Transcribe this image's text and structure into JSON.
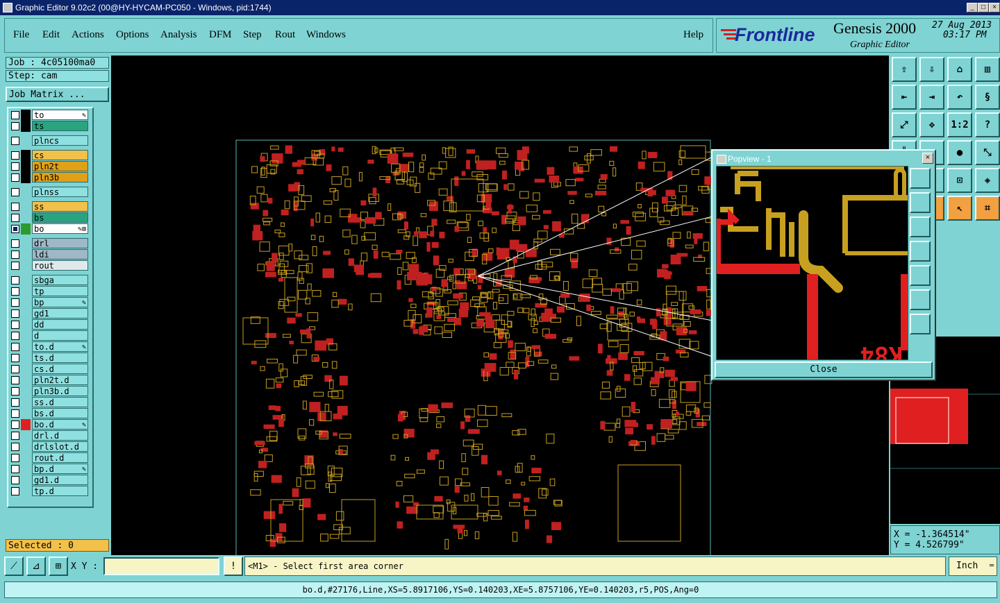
{
  "window": {
    "title": "Graphic Editor 9.02c2 (00@HY-HYCAM-PC050 - Windows, pid:1744)"
  },
  "menu": {
    "items": [
      "File",
      "Edit",
      "Actions",
      "Options",
      "Analysis",
      "DFM",
      "Step",
      "Rout",
      "Windows"
    ],
    "help": "Help"
  },
  "brand": {
    "logo": "Frontline",
    "product": "Genesis 2000",
    "sub": "Graphic Editor",
    "date": "27 Aug 2013",
    "time": "03:17 PM"
  },
  "job": {
    "job_label": "Job : 4c05100ma0",
    "step_label": "Step: cam",
    "matrix_button": "Job Matrix ..."
  },
  "layers": [
    {
      "name": "to",
      "color": "#ffffff",
      "swatch": "#000000",
      "mark": "✎"
    },
    {
      "name": "ts",
      "color": "#2aa37f",
      "swatch": "#000000",
      "mark": ""
    },
    {
      "name": "plncs",
      "color": "#8fe0e0",
      "swatch": "#7fd3d3",
      "mark": ""
    },
    {
      "name": "cs",
      "color": "#f2c14a",
      "swatch": "#000000",
      "mark": ""
    },
    {
      "name": "pln2t",
      "color": "#e0a018",
      "swatch": "#000000",
      "mark": ""
    },
    {
      "name": "pln3b",
      "color": "#e0a018",
      "swatch": "#000000",
      "mark": ""
    },
    {
      "name": "plnss",
      "color": "#8fe0e0",
      "swatch": "#7fd3d3",
      "mark": ""
    },
    {
      "name": "ss",
      "color": "#f2c14a",
      "swatch": "#7fd3d3",
      "mark": ""
    },
    {
      "name": "bs",
      "color": "#2aa37f",
      "swatch": "#7fd3d3",
      "mark": ""
    },
    {
      "name": "bo",
      "color": "#ffffff",
      "swatch": "#2e9a2e",
      "mark": "✎⊞"
    },
    {
      "name": "drl",
      "color": "#9fb8c8",
      "swatch": "#7fd3d3",
      "mark": ""
    },
    {
      "name": "ldi",
      "color": "#9fb8c8",
      "swatch": "#7fd3d3",
      "mark": ""
    },
    {
      "name": "rout",
      "color": "#e0e8ec",
      "swatch": "#7fd3d3",
      "mark": ""
    },
    {
      "name": "sbga",
      "color": "#8fe0e0",
      "swatch": "#7fd3d3",
      "mark": ""
    },
    {
      "name": "tp",
      "color": "#8fe0e0",
      "swatch": "#7fd3d3",
      "mark": ""
    },
    {
      "name": "bp",
      "color": "#8fe0e0",
      "swatch": "#7fd3d3",
      "mark": "✎"
    },
    {
      "name": "gd1",
      "color": "#8fe0e0",
      "swatch": "#7fd3d3",
      "mark": ""
    },
    {
      "name": "dd",
      "color": "#8fe0e0",
      "swatch": "#7fd3d3",
      "mark": ""
    },
    {
      "name": "d",
      "color": "#8fe0e0",
      "swatch": "#7fd3d3",
      "mark": ""
    },
    {
      "name": "to.d",
      "color": "#8fe0e0",
      "swatch": "#7fd3d3",
      "mark": "✎"
    },
    {
      "name": "ts.d",
      "color": "#8fe0e0",
      "swatch": "#7fd3d3",
      "mark": ""
    },
    {
      "name": "cs.d",
      "color": "#8fe0e0",
      "swatch": "#7fd3d3",
      "mark": ""
    },
    {
      "name": "pln2t.d",
      "color": "#8fe0e0",
      "swatch": "#7fd3d3",
      "mark": ""
    },
    {
      "name": "pln3b.d",
      "color": "#8fe0e0",
      "swatch": "#7fd3d3",
      "mark": ""
    },
    {
      "name": "ss.d",
      "color": "#8fe0e0",
      "swatch": "#7fd3d3",
      "mark": ""
    },
    {
      "name": "bs.d",
      "color": "#8fe0e0",
      "swatch": "#7fd3d3",
      "mark": ""
    },
    {
      "name": "bo.d",
      "color": "#8fe0e0",
      "swatch": "#e02020",
      "mark": "✎"
    },
    {
      "name": "drl.d",
      "color": "#8fe0e0",
      "swatch": "#7fd3d3",
      "mark": ""
    },
    {
      "name": "drlslot.d",
      "color": "#8fe0e0",
      "swatch": "#7fd3d3",
      "mark": ""
    },
    {
      "name": "rout.d",
      "color": "#8fe0e0",
      "swatch": "#7fd3d3",
      "mark": ""
    },
    {
      "name": "bp.d",
      "color": "#8fe0e0",
      "swatch": "#7fd3d3",
      "mark": "✎"
    },
    {
      "name": "gd1.d",
      "color": "#8fe0e0",
      "swatch": "#7fd3d3",
      "mark": ""
    },
    {
      "name": "tp.d",
      "color": "#8fe0e0",
      "swatch": "#7fd3d3",
      "mark": ""
    }
  ],
  "selected": "Selected : 0",
  "popview": {
    "title": "Popview - 1",
    "close": "Close",
    "text_fragment": "K84"
  },
  "coords": {
    "x": "X = -1.364514\"",
    "y": "Y = 4.526799\""
  },
  "cmd": {
    "xy_label": "X Y :",
    "xy_value": "",
    "prompt": "<M1> - Select first area corner",
    "unit": "Inch",
    "bang": "!"
  },
  "status": "bo.d,#27176,Line,XS=5.8917106,YS=0.140203,XE=5.8757106,YE=0.140203,r5,POS,Ang=0",
  "toolbar_icons": [
    "zoom-home",
    "zoom-in",
    "home-icon",
    "window-split",
    "pan-left",
    "pan-right",
    "undo-view",
    "measure",
    "fit-screen",
    "center-view",
    "scale-1-2",
    "help-icon",
    "snap",
    "ruler",
    "dot",
    "connect",
    "undo-rotate",
    "mirror",
    "select-area",
    "layers",
    "arrow-triangle",
    "arrow-triangle",
    "select-cursor",
    "graph-edit"
  ],
  "colors": {
    "accent": "#7fd3d3",
    "trace_gold": "#c8a020",
    "trace_red": "#e02020"
  }
}
